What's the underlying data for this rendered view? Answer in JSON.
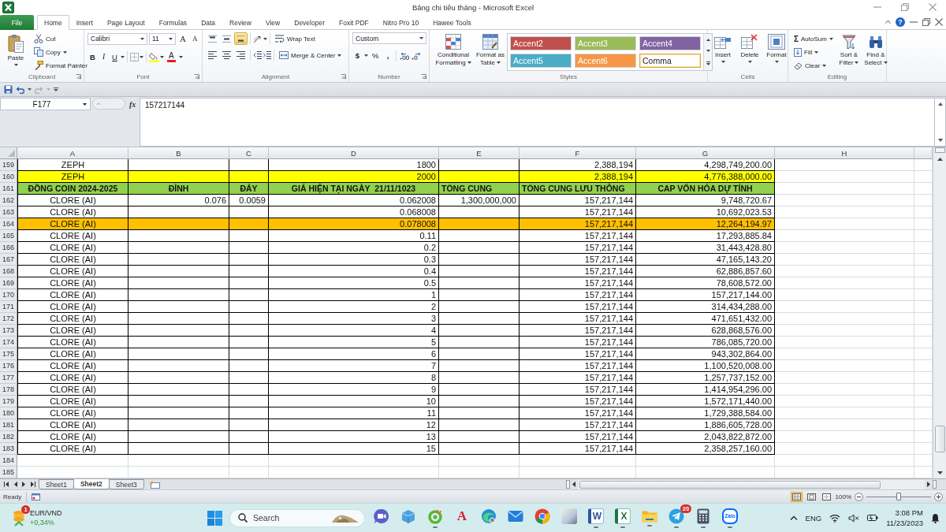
{
  "window": {
    "title": "Bảng chi tiêu tháng - Microsoft Excel",
    "help": "?"
  },
  "ribbon_tabs": [
    {
      "kind": "file",
      "label": "File",
      "selected": false
    },
    {
      "kind": "tab",
      "label": "Home",
      "selected": true
    },
    {
      "kind": "tab",
      "label": "Insert",
      "selected": false
    },
    {
      "kind": "tab",
      "label": "Page Layout",
      "selected": false
    },
    {
      "kind": "tab",
      "label": "Formulas",
      "selected": false
    },
    {
      "kind": "tab",
      "label": "Data",
      "selected": false
    },
    {
      "kind": "tab",
      "label": "Review",
      "selected": false
    },
    {
      "kind": "tab",
      "label": "View",
      "selected": false
    },
    {
      "kind": "tab",
      "label": "Developer",
      "selected": false
    },
    {
      "kind": "tab",
      "label": "Foxit PDF",
      "selected": false
    },
    {
      "kind": "tab",
      "label": "Nitro Pro 10",
      "selected": false
    },
    {
      "kind": "tab",
      "label": "Hawee Tools",
      "selected": false
    }
  ],
  "ribbon": {
    "clipboard": {
      "label": "Clipboard",
      "paste": "Paste",
      "cut": "Cut",
      "copy": "Copy",
      "format_painter": "Format Painter"
    },
    "font": {
      "label": "Font",
      "font_name": "Calibri",
      "font_size": "11",
      "grow": "A",
      "shrink": "A",
      "bold": "B",
      "italic": "I",
      "underline": "U",
      "font_color": "A"
    },
    "alignment": {
      "label": "Alignment",
      "vertical_align": [
        {
          "kind": "top",
          "selected": false
        },
        {
          "kind": "middle",
          "selected": false
        },
        {
          "kind": "bottom",
          "selected": true
        }
      ],
      "wrap_text": "Wrap Text",
      "merge_center": "Merge & Center"
    },
    "number": {
      "label": "Number",
      "format": "Custom",
      "currency": "$",
      "percent": "%",
      "comma": ","
    },
    "styles": {
      "label": "Styles",
      "conditional_formatting": "Conditional Formatting",
      "format_as_table": "Format as Table",
      "gallery": [
        {
          "label": "Accent2",
          "color": "#c0504d",
          "selected": false
        },
        {
          "label": "Accent3",
          "color": "#9bbb59",
          "selected": false
        },
        {
          "label": "Accent4",
          "color": "#8064a2",
          "selected": false
        },
        {
          "label": "Accent5",
          "color": "#4bacc6",
          "selected": false
        },
        {
          "label": "Accent6",
          "color": "#f79646",
          "selected": false
        },
        {
          "label": "Comma",
          "color": "#ffffff",
          "selected": true
        }
      ]
    },
    "cells": {
      "label": "Cells",
      "buttons": [
        {
          "kind": "insert",
          "label": "Insert"
        },
        {
          "kind": "delete",
          "label": "Delete"
        },
        {
          "kind": "format",
          "label": "Format"
        }
      ]
    },
    "editing": {
      "label": "Editing",
      "autosum_symbol": "Σ",
      "autosum": "AutoSum",
      "fill": "Fill",
      "clear": "Clear",
      "sort_filter": "Sort & Filter",
      "find_select": "Find & Select"
    }
  },
  "formula_bar": {
    "name_box": "F177",
    "function_button": "fx",
    "value": "157217144"
  },
  "sheet": {
    "columns": [
      "A",
      "B",
      "C",
      "D",
      "E",
      "F",
      "G",
      "H"
    ],
    "rows": [
      {
        "number": "159",
        "kind": "data",
        "color": "#ffffff",
        "cells": [
          "ZEPH",
          null,
          null,
          "1800",
          null,
          "2,388,194",
          "4,298,749,200.00"
        ]
      },
      {
        "number": "160",
        "kind": "data",
        "color": "#ffff00",
        "cells": [
          "ZEPH",
          null,
          null,
          "2000",
          null,
          "2,388,194",
          "4,776,388,000.00"
        ]
      },
      {
        "number": "161",
        "kind": "header",
        "color": "#92d050",
        "cells": [
          "ĐỒNG COIN 2024-2025",
          "ĐỈNH",
          "ĐÁY",
          "GIÁ HIỆN TẠI NGÀY  21/11/1023",
          "TỔNG CUNG",
          "TỔNG CUNG LƯU THÔNG",
          "CAP VỐN HÓA DỰ TÍNH"
        ]
      },
      {
        "number": "162",
        "kind": "data",
        "color": "#ffffff",
        "cells": [
          "CLORE (AI)",
          "0.076",
          "0.0059",
          "0.062008",
          "1,300,000,000",
          "157,217,144",
          "9,748,720.67"
        ]
      },
      {
        "number": "163",
        "kind": "data",
        "color": "#ffffff",
        "cells": [
          "CLORE (AI)",
          null,
          null,
          "0.068008",
          null,
          "157,217,144",
          "10,692,023.53"
        ]
      },
      {
        "number": "164",
        "kind": "data",
        "color": "#ffc000",
        "cells": [
          "CLORE (AI)",
          null,
          null,
          "0.078008",
          null,
          "157,217,144",
          "12,264,194.97"
        ]
      },
      {
        "number": "165",
        "kind": "data",
        "color": "#ffffff",
        "cells": [
          "CLORE (AI)",
          null,
          null,
          "0.11",
          null,
          "157,217,144",
          "17,293,885.84"
        ]
      },
      {
        "number": "166",
        "kind": "data",
        "color": "#ffffff",
        "cells": [
          "CLORE (AI)",
          null,
          null,
          "0.2",
          null,
          "157,217,144",
          "31,443,428.80"
        ]
      },
      {
        "number": "167",
        "kind": "data",
        "color": "#ffffff",
        "cells": [
          "CLORE (AI)",
          null,
          null,
          "0.3",
          null,
          "157,217,144",
          "47,165,143.20"
        ]
      },
      {
        "number": "168",
        "kind": "data",
        "color": "#ffffff",
        "cells": [
          "CLORE (AI)",
          null,
          null,
          "0.4",
          null,
          "157,217,144",
          "62,886,857.60"
        ]
      },
      {
        "number": "169",
        "kind": "data",
        "color": "#ffffff",
        "cells": [
          "CLORE (AI)",
          null,
          null,
          "0.5",
          null,
          "157,217,144",
          "78,608,572.00"
        ]
      },
      {
        "number": "170",
        "kind": "data",
        "color": "#ffffff",
        "cells": [
          "CLORE (AI)",
          null,
          null,
          "1",
          null,
          "157,217,144",
          "157,217,144.00"
        ]
      },
      {
        "number": "171",
        "kind": "data",
        "color": "#ffffff",
        "cells": [
          "CLORE (AI)",
          null,
          null,
          "2",
          null,
          "157,217,144",
          "314,434,288.00"
        ]
      },
      {
        "number": "172",
        "kind": "data",
        "color": "#ffffff",
        "cells": [
          "CLORE (AI)",
          null,
          null,
          "3",
          null,
          "157,217,144",
          "471,651,432.00"
        ]
      },
      {
        "number": "173",
        "kind": "data",
        "color": "#ffffff",
        "cells": [
          "CLORE (AI)",
          null,
          null,
          "4",
          null,
          "157,217,144",
          "628,868,576.00"
        ]
      },
      {
        "number": "174",
        "kind": "data",
        "color": "#ffffff",
        "cells": [
          "CLORE (AI)",
          null,
          null,
          "5",
          null,
          "157,217,144",
          "786,085,720.00"
        ]
      },
      {
        "number": "175",
        "kind": "data",
        "color": "#ffffff",
        "cells": [
          "CLORE (AI)",
          null,
          null,
          "6",
          null,
          "157,217,144",
          "943,302,864.00"
        ]
      },
      {
        "number": "176",
        "kind": "data",
        "color": "#ffffff",
        "cells": [
          "CLORE (AI)",
          null,
          null,
          "7",
          null,
          "157,217,144",
          "1,100,520,008.00"
        ]
      },
      {
        "number": "177",
        "kind": "data",
        "color": "#ffffff",
        "cells": [
          "CLORE (AI)",
          null,
          null,
          "8",
          null,
          "157,217,144",
          "1,257,737,152.00"
        ]
      },
      {
        "number": "178",
        "kind": "data",
        "color": "#ffffff",
        "cells": [
          "CLORE (AI)",
          null,
          null,
          "9",
          null,
          "157,217,144",
          "1,414,954,296.00"
        ]
      },
      {
        "number": "179",
        "kind": "data",
        "color": "#ffffff",
        "cells": [
          "CLORE (AI)",
          null,
          null,
          "10",
          null,
          "157,217,144",
          "1,572,171,440.00"
        ]
      },
      {
        "number": "180",
        "kind": "data",
        "color": "#ffffff",
        "cells": [
          "CLORE (AI)",
          null,
          null,
          "11",
          null,
          "157,217,144",
          "1,729,388,584.00"
        ]
      },
      {
        "number": "181",
        "kind": "data",
        "color": "#ffffff",
        "cells": [
          "CLORE (AI)",
          null,
          null,
          "12",
          null,
          "157,217,144",
          "1,886,605,728.00"
        ]
      },
      {
        "number": "182",
        "kind": "data",
        "color": "#ffffff",
        "cells": [
          "CLORE (AI)",
          null,
          null,
          "13",
          null,
          "157,217,144",
          "2,043,822,872.00"
        ]
      },
      {
        "number": "183",
        "kind": "data",
        "color": "#ffffff",
        "cells": [
          "CLORE (AI)",
          null,
          null,
          "15",
          null,
          "157,217,144",
          "2,358,257,160.00"
        ]
      },
      {
        "number": "184",
        "kind": "empty"
      },
      {
        "number": "185",
        "kind": "empty"
      }
    ]
  },
  "sheet_tabs": [
    {
      "label": "Sheet1",
      "selected": false
    },
    {
      "label": "Sheet2",
      "selected": true
    },
    {
      "label": "Sheet3",
      "selected": false
    }
  ],
  "status_bar": {
    "status": "Ready",
    "views": [
      {
        "kind": "normal",
        "selected": true
      },
      {
        "kind": "page_layout",
        "selected": false
      },
      {
        "kind": "page_break",
        "selected": false
      }
    ],
    "zoom": "100%",
    "zoom_slider": {
      "level": 0.5
    }
  },
  "taskbar": {
    "widget": {
      "badge": "1",
      "title": "EUR/VND",
      "change": "+0,34%"
    },
    "search": {
      "placeholder": "Search"
    },
    "apps": [
      {
        "kind": "meet",
        "running": false
      },
      {
        "kind": "box",
        "running": false
      },
      {
        "kind": "ring",
        "running": true
      },
      {
        "kind": "red_letter",
        "glyph": "A",
        "running": false
      },
      {
        "kind": "swirl",
        "running": false
      },
      {
        "kind": "mail",
        "running": false
      },
      {
        "kind": "chrome",
        "running": false
      },
      {
        "kind": "photo",
        "running": false
      },
      {
        "kind": "blue_letter",
        "glyph": "W",
        "running": true
      },
      {
        "kind": "green_letter",
        "glyph": "X",
        "running": true
      },
      {
        "kind": "folder",
        "running": true
      },
      {
        "kind": "plane",
        "badge": "20",
        "running": true
      },
      {
        "kind": "calculator",
        "running": true
      },
      {
        "kind": "bubble",
        "glyph": "Zalo",
        "running": true
      }
    ],
    "tray": {
      "language": "ENG",
      "time": "3:08 PM",
      "date": "11/23/2023"
    }
  }
}
